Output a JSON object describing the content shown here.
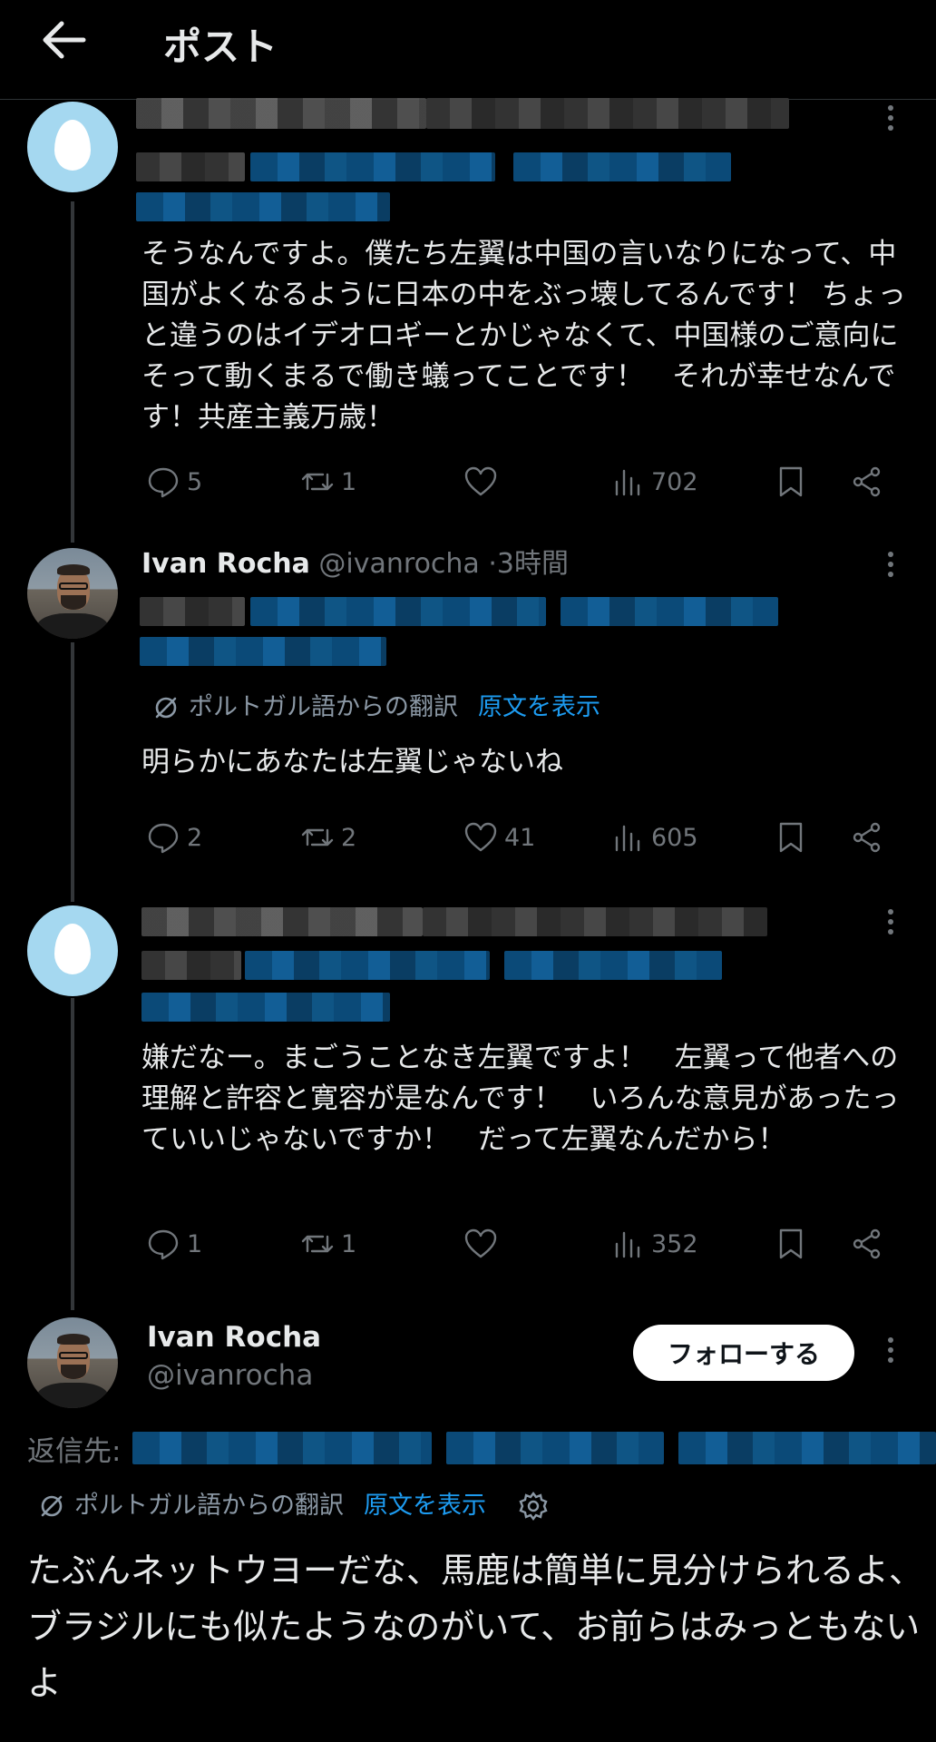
{
  "header": {
    "title": "ポスト"
  },
  "replies": [
    {
      "text": "そうなんですよ。僕たち左翼は中国の言いなりになって、中国がよくなるように日本の中をぶっ壊してるんです！ ちょっと違うのはイデオロギーとかじゃなくて、中国様のご意向にそって動くまるで働き蟻ってことです！　それが幸せなんです！共産主義万歳！",
      "stats": {
        "replies": "5",
        "reposts": "1",
        "likes": "",
        "views": "702"
      }
    },
    {
      "name": "Ivan Rocha",
      "handle": "@ivanrocha",
      "separator": "·",
      "time": "3時間",
      "translation": {
        "from": "ポルトガル語からの翻訳",
        "show_original": "原文を表示"
      },
      "text": "明らかにあなたは左翼じゃないね",
      "stats": {
        "replies": "2",
        "reposts": "2",
        "likes": "41",
        "views": "605"
      }
    },
    {
      "text": "嫌だなー。まごうことなき左翼ですよ！　左翼って他者への理解と許容と寛容が是なんです！　いろんな意見があったっていいじゃないですか！　だって左翼なんだから！",
      "stats": {
        "replies": "1",
        "reposts": "1",
        "likes": "",
        "views": "352"
      }
    }
  ],
  "main_post": {
    "name": "Ivan Rocha",
    "handle": "@ivanrocha",
    "follow_label": "フォローする",
    "reply_to_label": "返信先:",
    "translation": {
      "from": "ポルトガル語からの翻訳",
      "show_original": "原文を表示"
    },
    "text": "たぶんネットウヨーだな、馬鹿は簡単に見分けられるよ、ブラジルにも似たようなのがいて、お前らはみっともないよ"
  },
  "colors": {
    "background": "#000000",
    "text": "#e7e9ea",
    "muted": "#71767b",
    "link": "#1d9bf0",
    "thread_line": "#333639"
  },
  "icons": [
    "back-arrow-icon",
    "more-icon",
    "reply-icon",
    "repost-icon",
    "like-icon",
    "views-icon",
    "bookmark-icon",
    "share-icon",
    "translate-icon",
    "gear-icon"
  ]
}
